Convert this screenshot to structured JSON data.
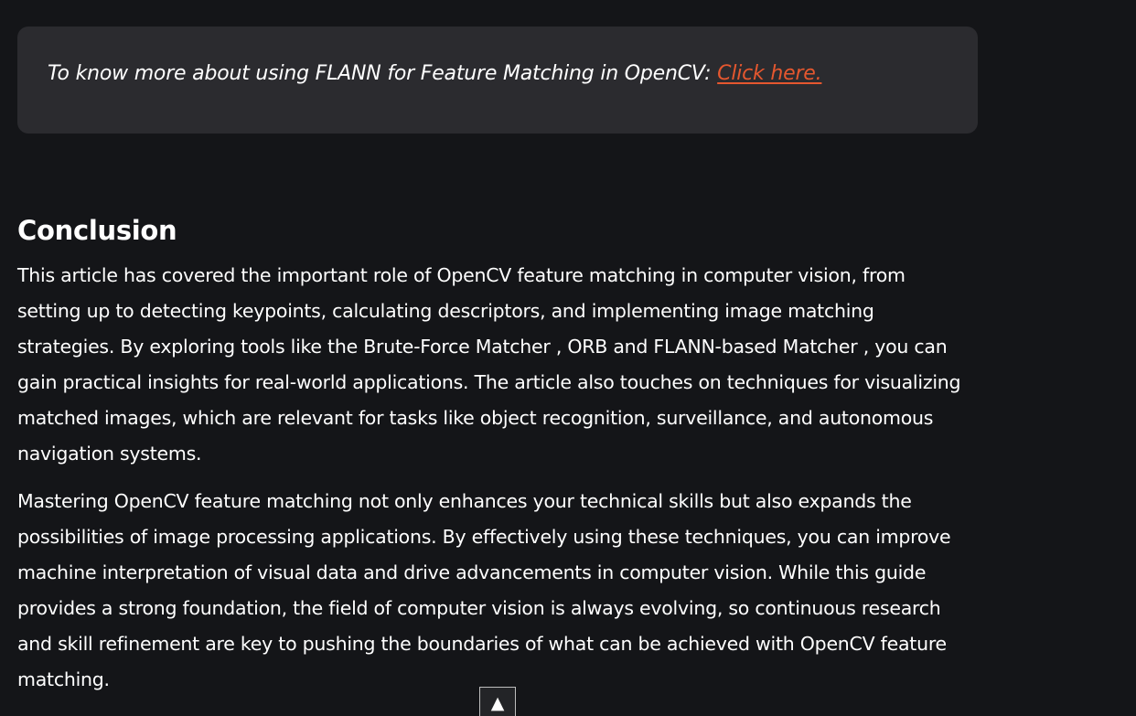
{
  "note": {
    "text": "To know more about using FLANN for Feature Matching in OpenCV: ",
    "link_label": "Click here."
  },
  "conclusion": {
    "heading": "Conclusion",
    "paragraph_1": "This article has covered the important role of OpenCV feature matching in computer vision, from setting up to detecting keypoints, calculating descriptors, and implementing image matching strategies. By exploring tools like the Brute-Force Matcher , ORB and FLANN-based Matcher , you can gain practical insights for real-world applications. The article also touches on techniques for visualizing matched images, which are relevant for tasks like object recognition, surveillance, and autonomous navigation systems.",
    "paragraph_2": "Mastering OpenCV feature matching not only enhances your technical skills but also expands the possibilities of image processing applications. By effectively using these techniques, you can improve machine interpretation of visual data and drive advancements in computer vision. While this guide provides a strong foundation, the field of computer vision is always evolving, so continuous research and skill refinement are key to pushing the boundaries of what can be achieved with OpenCV feature matching."
  },
  "scroll_top": {
    "icon": "arrow-up-icon",
    "glyph": "▲"
  },
  "colors": {
    "background": "#141518",
    "note_box": "#2b2b2f",
    "link": "#e5572f",
    "text": "#ffffff"
  }
}
